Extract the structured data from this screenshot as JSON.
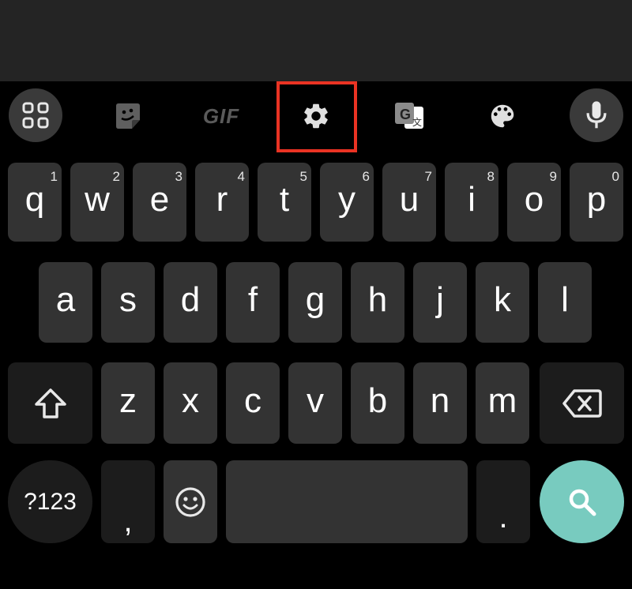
{
  "toolbar": {
    "items": [
      {
        "name": "apps",
        "icon": "grid-icon"
      },
      {
        "name": "sticker",
        "icon": "sticker-icon"
      },
      {
        "name": "gif",
        "label": "GIF"
      },
      {
        "name": "settings",
        "icon": "gear-icon",
        "highlighted": true
      },
      {
        "name": "translate",
        "icon": "translate-icon"
      },
      {
        "name": "theme",
        "icon": "palette-icon"
      },
      {
        "name": "voice",
        "icon": "mic-icon"
      }
    ],
    "highlight_color": "#ea3323"
  },
  "keyboard": {
    "row1": [
      {
        "letter": "q",
        "hint": "1"
      },
      {
        "letter": "w",
        "hint": "2"
      },
      {
        "letter": "e",
        "hint": "3"
      },
      {
        "letter": "r",
        "hint": "4"
      },
      {
        "letter": "t",
        "hint": "5"
      },
      {
        "letter": "y",
        "hint": "6"
      },
      {
        "letter": "u",
        "hint": "7"
      },
      {
        "letter": "i",
        "hint": "8"
      },
      {
        "letter": "o",
        "hint": "9"
      },
      {
        "letter": "p",
        "hint": "0"
      }
    ],
    "row2": [
      "a",
      "s",
      "d",
      "f",
      "g",
      "h",
      "j",
      "k",
      "l"
    ],
    "row3": [
      "z",
      "x",
      "c",
      "v",
      "b",
      "n",
      "m"
    ],
    "shift_icon": "shift-icon",
    "backspace_icon": "backspace-icon",
    "symbols_label": "?123",
    "comma_label": ",",
    "emoji_icon": "emoji-icon",
    "period_label": ".",
    "search_icon": "search-icon",
    "search_color": "#78cbbf"
  }
}
